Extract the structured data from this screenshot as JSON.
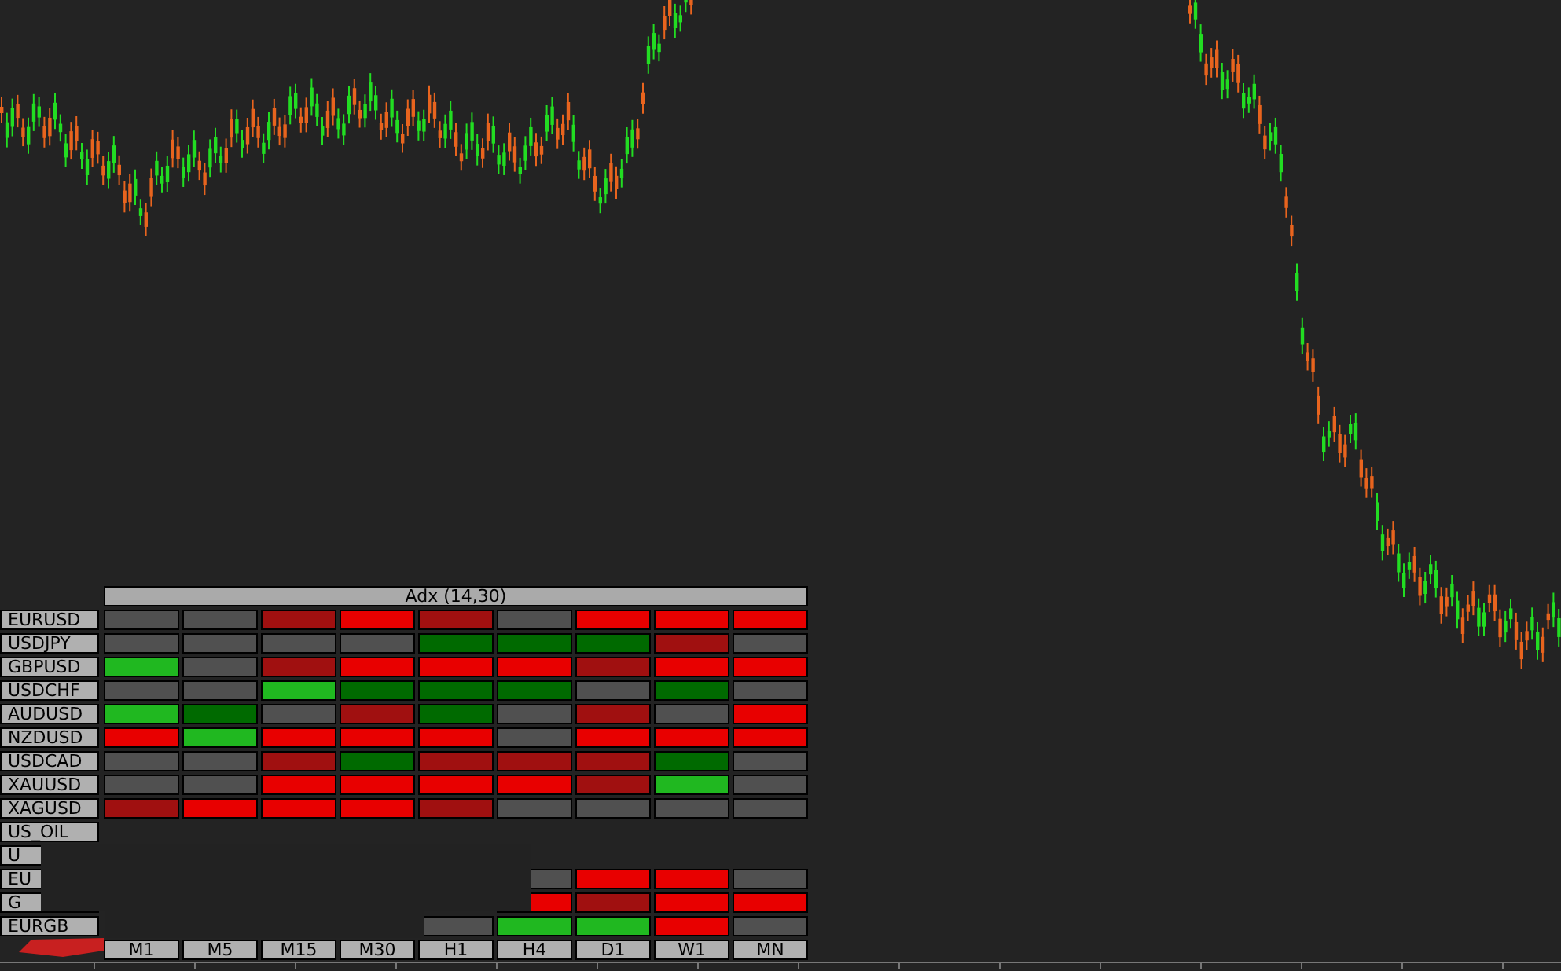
{
  "indicator_panel": {
    "title": "Adx (14,30)",
    "rows": [
      {
        "symbol": "EURUSD",
        "cells": [
          {
            "color": "#505050"
          },
          {
            "color": "#505050"
          },
          {
            "color": "#a01010"
          },
          {
            "color": "#e80000"
          },
          {
            "color": "#a01010"
          },
          {
            "color": "#505050"
          },
          {
            "color": "#e80000"
          },
          {
            "color": "#e80000"
          },
          {
            "color": "#e80000"
          }
        ]
      },
      {
        "symbol": "USDJPY",
        "cells": [
          {
            "color": "#505050"
          },
          {
            "color": "#505050"
          },
          {
            "color": "#505050"
          },
          {
            "color": "#505050"
          },
          {
            "color": "#006a00"
          },
          {
            "color": "#006a00"
          },
          {
            "color": "#006a00"
          },
          {
            "color": "#a01010"
          },
          {
            "color": "#505050"
          }
        ]
      },
      {
        "symbol": "GBPUSD",
        "cells": [
          {
            "color": "#20b820"
          },
          {
            "color": "#505050"
          },
          {
            "color": "#a01010"
          },
          {
            "color": "#e80000"
          },
          {
            "color": "#e80000"
          },
          {
            "color": "#e80000"
          },
          {
            "color": "#a01010"
          },
          {
            "color": "#e80000"
          },
          {
            "color": "#e80000"
          }
        ]
      },
      {
        "symbol": "USDCHF",
        "cells": [
          {
            "color": "#505050"
          },
          {
            "color": "#505050"
          },
          {
            "color": "#20b820"
          },
          {
            "color": "#006a00"
          },
          {
            "color": "#006a00"
          },
          {
            "color": "#006a00"
          },
          {
            "color": "#505050"
          },
          {
            "color": "#006a00"
          },
          {
            "color": "#505050"
          }
        ]
      },
      {
        "symbol": "AUDUSD",
        "cells": [
          {
            "color": "#20b820"
          },
          {
            "color": "#006a00"
          },
          {
            "color": "#505050"
          },
          {
            "color": "#a01010"
          },
          {
            "color": "#006a00"
          },
          {
            "color": "#505050"
          },
          {
            "color": "#a01010"
          },
          {
            "color": "#505050"
          },
          {
            "color": "#e80000"
          }
        ]
      },
      {
        "symbol": "NZDUSD",
        "cells": [
          {
            "color": "#e80000"
          },
          {
            "color": "#20b820"
          },
          {
            "color": "#e80000"
          },
          {
            "color": "#e80000"
          },
          {
            "color": "#e80000"
          },
          {
            "color": "#505050"
          },
          {
            "color": "#e80000"
          },
          {
            "color": "#e80000"
          },
          {
            "color": "#e80000"
          }
        ]
      },
      {
        "symbol": "USDCAD",
        "cells": [
          {
            "color": "#505050"
          },
          {
            "color": "#505050"
          },
          {
            "color": "#a01010"
          },
          {
            "color": "#006a00"
          },
          {
            "color": "#a01010"
          },
          {
            "color": "#a01010"
          },
          {
            "color": "#a01010"
          },
          {
            "color": "#006a00"
          },
          {
            "color": "#505050"
          }
        ]
      },
      {
        "symbol": "XAUUSD",
        "cells": [
          {
            "color": "#505050"
          },
          {
            "color": "#505050"
          },
          {
            "color": "#e80000"
          },
          {
            "color": "#e80000"
          },
          {
            "color": "#e80000"
          },
          {
            "color": "#e80000"
          },
          {
            "color": "#a01010"
          },
          {
            "color": "#20b820"
          },
          {
            "color": "#505050"
          }
        ]
      },
      {
        "symbol": "XAGUSD",
        "cells": [
          {
            "color": "#a01010"
          },
          {
            "color": "#e80000"
          },
          {
            "color": "#e80000"
          },
          {
            "color": "#e80000"
          },
          {
            "color": "#a01010"
          },
          {
            "color": "#505050"
          },
          {
            "color": "#505050"
          },
          {
            "color": "#505050"
          },
          {
            "color": "#505050"
          }
        ]
      },
      {
        "symbol": "US_OIL",
        "cells": [
          null,
          null,
          null,
          null,
          null,
          null,
          null,
          null,
          null
        ]
      },
      {
        "symbol": "U",
        "cells": [
          null,
          null,
          null,
          null,
          null,
          null,
          null,
          null,
          null
        ]
      },
      {
        "symbol": "EU",
        "cells": [
          null,
          null,
          null,
          null,
          null,
          {
            "color": "#505050"
          },
          {
            "color": "#e80000"
          },
          {
            "color": "#e80000"
          },
          {
            "color": "#505050"
          }
        ]
      },
      {
        "symbol": "G",
        "cells": [
          null,
          null,
          null,
          null,
          null,
          {
            "color": "#e80000"
          },
          {
            "color": "#a01010"
          },
          {
            "color": "#e80000"
          },
          {
            "color": "#e80000"
          }
        ]
      },
      {
        "symbol": "EURGB",
        "cells": [
          null,
          null,
          null,
          null,
          {
            "color": "#505050"
          },
          {
            "color": "#20b820"
          },
          {
            "color": "#20b820"
          },
          {
            "color": "#e80000"
          },
          {
            "color": "#505050"
          }
        ]
      }
    ],
    "timeframes": [
      "M1",
      "M5",
      "M15",
      "M30",
      "H1",
      "H4",
      "D1",
      "W1",
      "MN"
    ]
  }
}
